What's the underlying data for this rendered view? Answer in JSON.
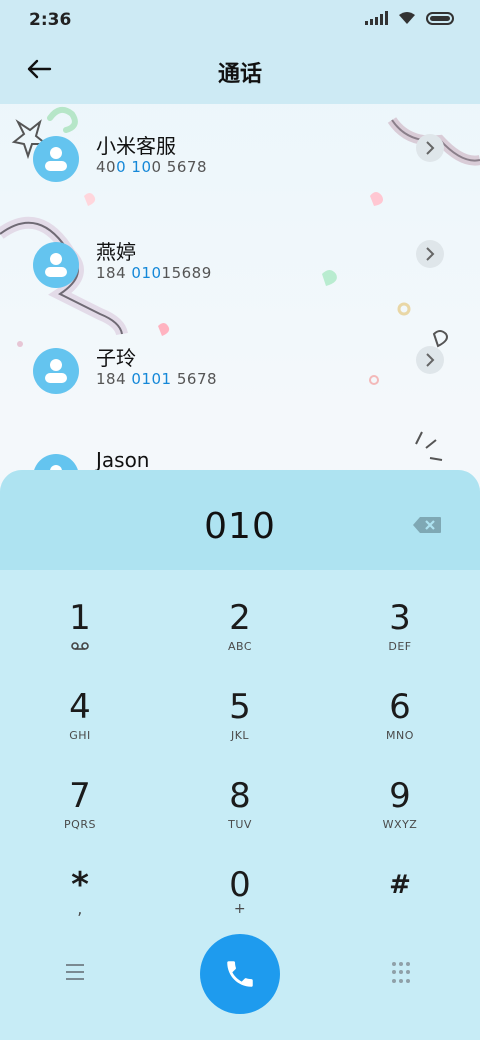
{
  "status": {
    "time": "2:36"
  },
  "header": {
    "title": "通话"
  },
  "contacts": [
    {
      "name": "小米客服",
      "num_parts": [
        "40",
        "0 10",
        "0 5678"
      ],
      "visible_number": "400 100 5678"
    },
    {
      "name": "燕婷",
      "num_parts": [
        "184 ",
        "010",
        "15689"
      ],
      "visible_number": "184 01015689"
    },
    {
      "name": "子玲",
      "num_parts": [
        "184 ",
        "0101",
        " 5678"
      ],
      "visible_number": "184 0101 5678"
    },
    {
      "name": "Jason",
      "num_parts": [
        "",
        "",
        ""
      ],
      "visible_number": ""
    }
  ],
  "dialer": {
    "number": "010",
    "keys": [
      {
        "digit": "1",
        "sub": ""
      },
      {
        "digit": "2",
        "sub": "ABC"
      },
      {
        "digit": "3",
        "sub": "DEF"
      },
      {
        "digit": "4",
        "sub": "GHI"
      },
      {
        "digit": "5",
        "sub": "JKL"
      },
      {
        "digit": "6",
        "sub": "MNO"
      },
      {
        "digit": "7",
        "sub": "PQRS"
      },
      {
        "digit": "8",
        "sub": "TUV"
      },
      {
        "digit": "9",
        "sub": "WXYZ"
      },
      {
        "digit": "*",
        "sub": ","
      },
      {
        "digit": "0",
        "sub": "+"
      },
      {
        "digit": "#",
        "sub": ""
      }
    ]
  },
  "colors": {
    "accent": "#1e9bee",
    "avatar": "#64c4ef",
    "highlight": "#1588d8",
    "panel": "#c7ecf6"
  },
  "icons": {
    "back": "arrow-left-icon",
    "backspace": "backspace-icon",
    "voicemail": "voicemail-icon",
    "menu": "menu-icon",
    "call": "phone-icon",
    "dialpad": "dialpad-icon"
  }
}
